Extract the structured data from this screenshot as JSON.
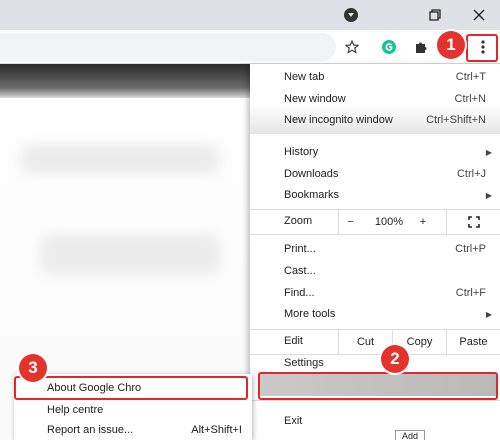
{
  "window": {
    "profile_icon": "account-circle-icon",
    "restore_icon": "restore-window-icon",
    "close_icon": "close-icon"
  },
  "toolbar": {
    "bookmark_star_icon": "star-icon",
    "extension_g_icon": "grammarly-icon",
    "extensions_icon": "puzzle-icon",
    "menu_icon": "three-dots-vertical-icon"
  },
  "menu": {
    "new_tab": {
      "label": "New tab",
      "shortcut": "Ctrl+T"
    },
    "new_window": {
      "label": "New window",
      "shortcut": "Ctrl+N"
    },
    "new_incognito": {
      "label": "New incognito window",
      "shortcut": "Ctrl+Shift+N"
    },
    "history": {
      "label": "History"
    },
    "downloads": {
      "label": "Downloads",
      "shortcut": "Ctrl+J"
    },
    "bookmarks": {
      "label": "Bookmarks"
    },
    "zoom": {
      "label": "Zoom",
      "minus": "−",
      "value": "100%",
      "plus": "+"
    },
    "print": {
      "label": "Print...",
      "shortcut": "Ctrl+P"
    },
    "cast": {
      "label": "Cast..."
    },
    "find": {
      "label": "Find...",
      "shortcut": "Ctrl+F"
    },
    "more_tools": {
      "label": "More tools"
    },
    "edit": {
      "label": "Edit",
      "cut": "Cut",
      "copy": "Copy",
      "paste": "Paste"
    },
    "settings": {
      "label": "Settings"
    },
    "exit": {
      "label": "Exit"
    }
  },
  "help_submenu": {
    "about": {
      "label": "About Google Chro"
    },
    "help_centre": {
      "label": "Help centre"
    },
    "report_issue": {
      "label": "Report an issue...",
      "shortcut": "Alt+Shift+I"
    }
  },
  "annotations": {
    "badge1": "1",
    "badge2": "2",
    "badge3": "3",
    "color": "#e4332c"
  },
  "page": {
    "add_button": "Add"
  }
}
